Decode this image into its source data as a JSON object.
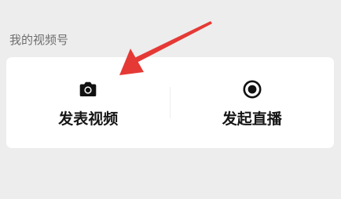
{
  "section": {
    "title": "我的视频号"
  },
  "actions": [
    {
      "label": "发表视频",
      "icon": "camera-icon"
    },
    {
      "label": "发起直播",
      "icon": "live-record-icon"
    }
  ],
  "colors": {
    "background": "#EDEDED",
    "card": "#FFFFFF",
    "title_text": "#6E6E6E",
    "label_text": "#161616",
    "annotation_arrow": "#E53935"
  }
}
